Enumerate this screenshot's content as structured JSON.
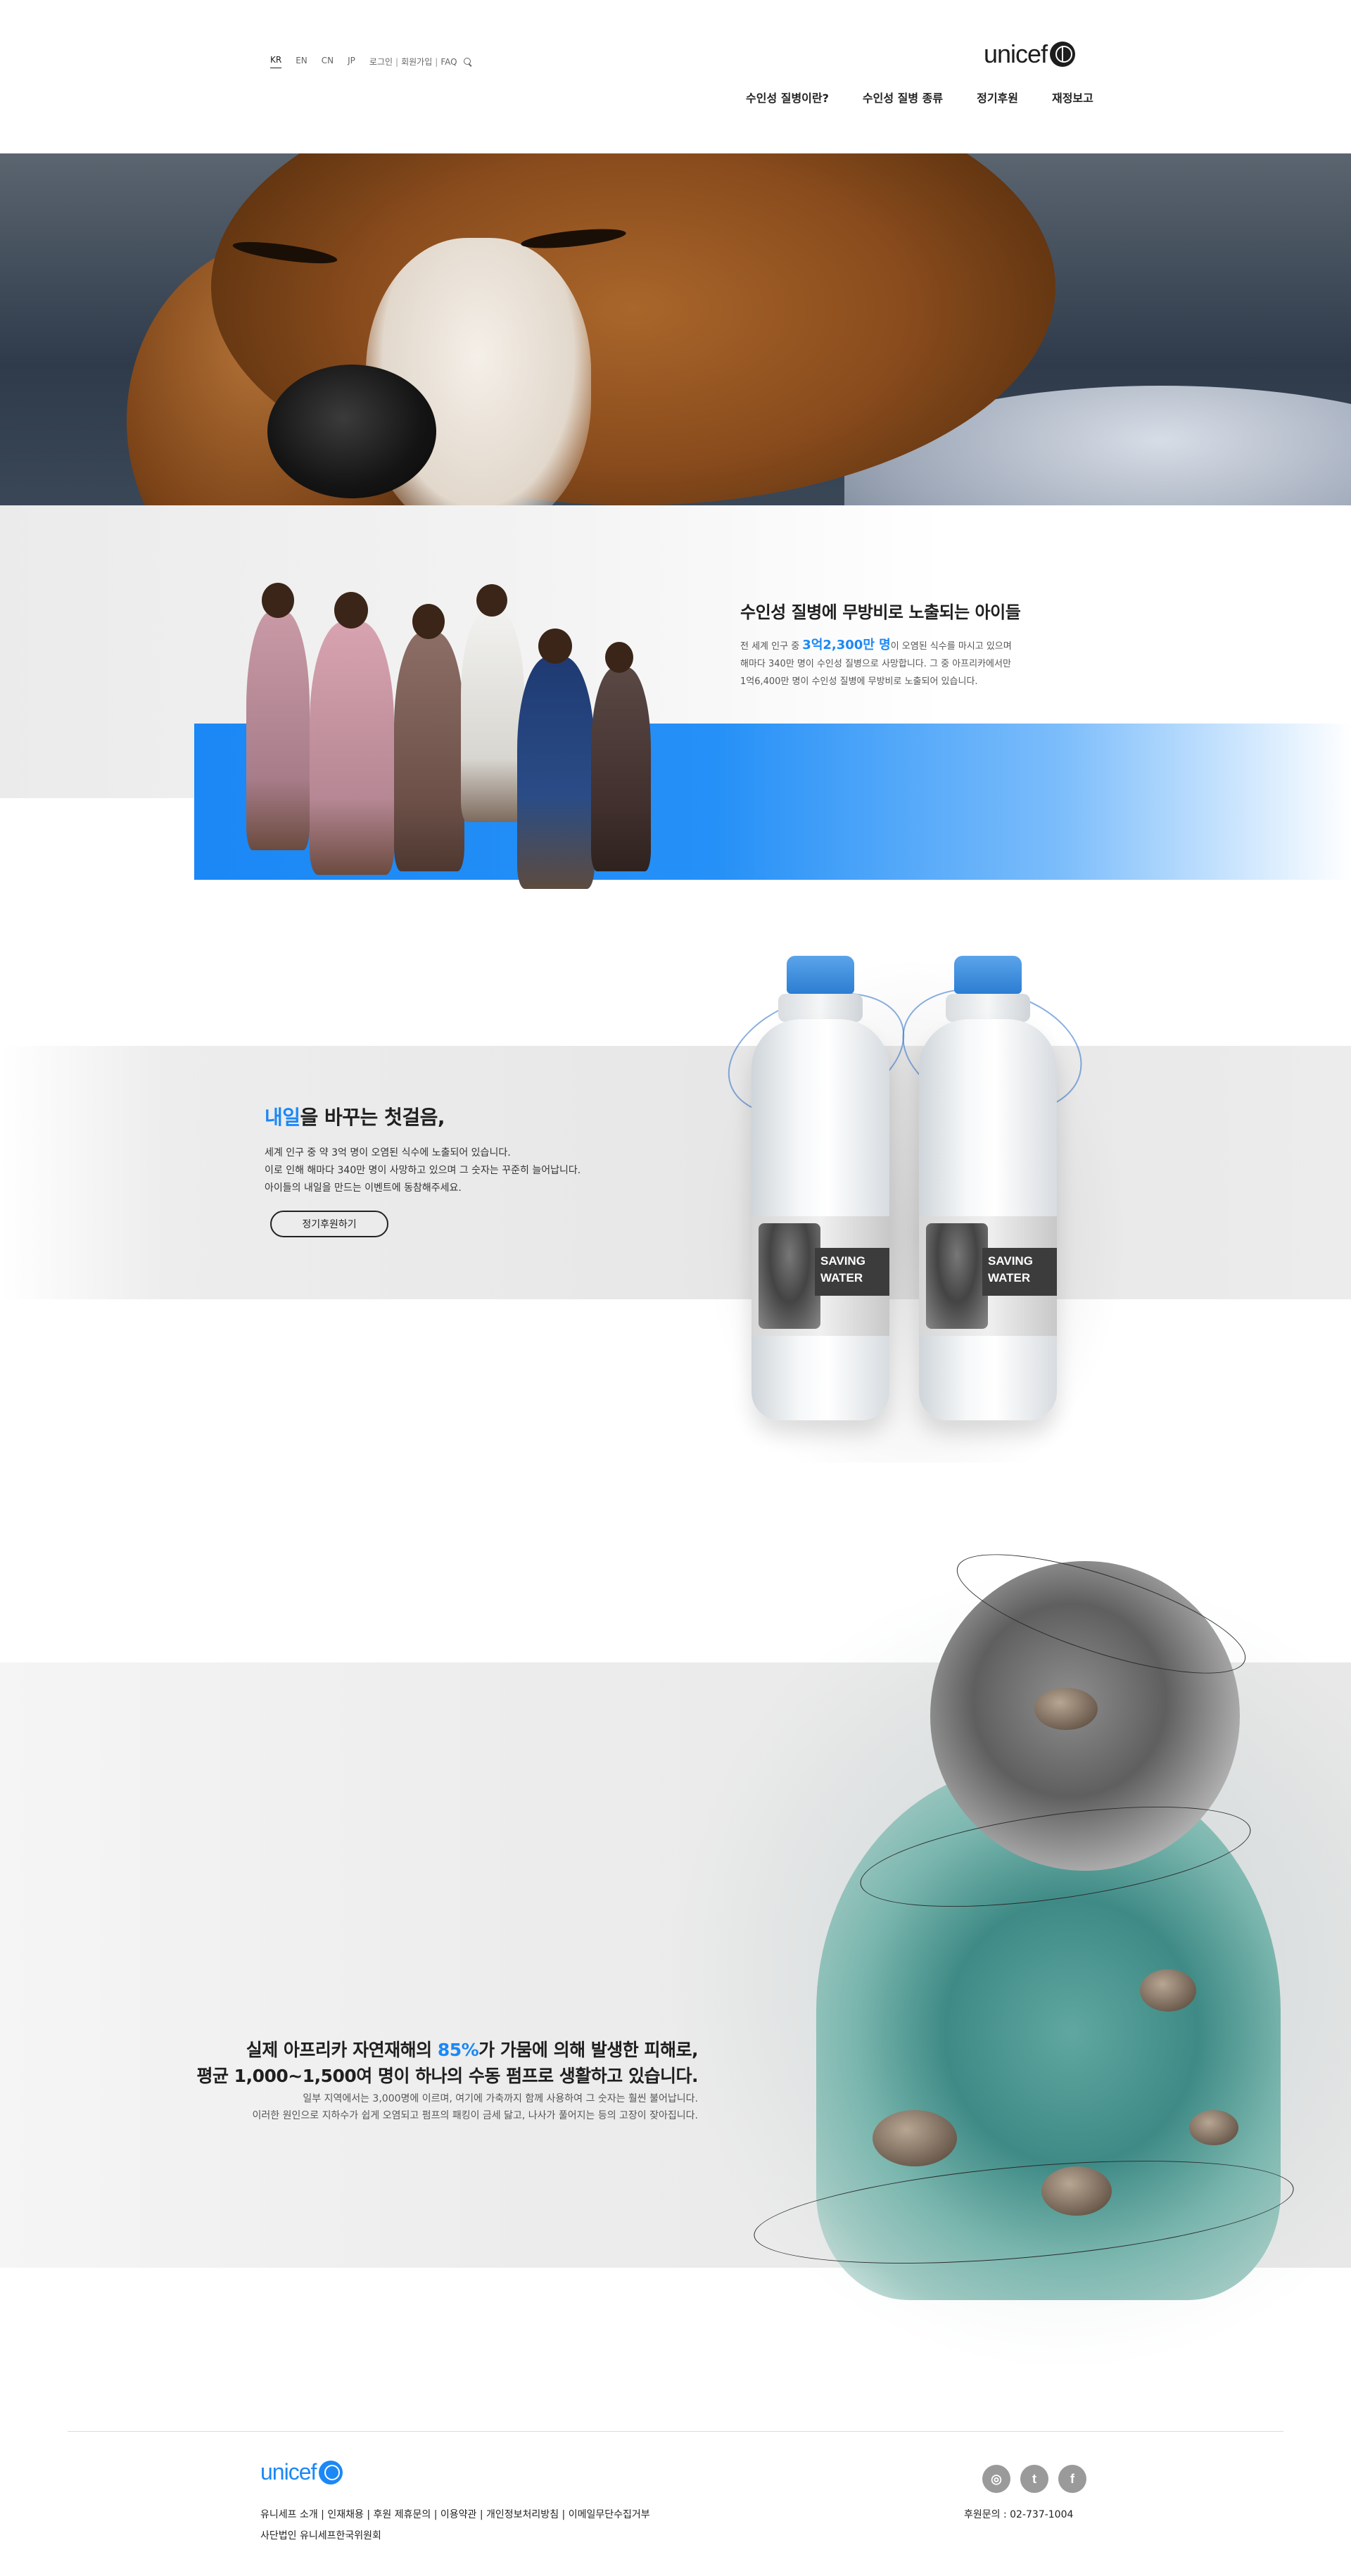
{
  "header": {
    "languages": [
      "KR",
      "EN",
      "CN",
      "JP"
    ],
    "login": "로그인",
    "signup": "회원가입",
    "faq": "FAQ",
    "logo_text": "unicef",
    "nav": [
      "수인성 질병이란?",
      "수인성 질병 종류",
      "정기후원",
      "재정보고"
    ]
  },
  "section_children": {
    "title": "수인성 질병에 무방비로 노출되는 아이들",
    "desc_line1_pre": "전 세계 인구 중 ",
    "desc_line1_highlight": "3억2,300만 명",
    "desc_line1_post": "이 오염된 식수를 마시고 있으며",
    "desc_line2": "해마다 340만 명이 수인성 질병으로 사망합니다. 그 중 아프리카에서만",
    "desc_line3": "1억6,400만 명이 수인성 질병에 무방비로 노출되어 있습니다."
  },
  "section_bottle": {
    "title_highlight": "내일",
    "title_rest": "을 바꾸는 첫걸음,",
    "desc_line1": "세계 인구 중 약 3억 명이 오염된 식수에 노출되어 있습니다.",
    "desc_line2": "이로 인해 해마다 340만 명이 사망하고 있으며 그 숫자는 꾸준히 늘어납니다.",
    "desc_line3": "아이들의 내일을 만드는 이벤트에 동참해주세요.",
    "button_label": "정기후원하기",
    "bottle_label_line1": "SAVING",
    "bottle_label_line2": "WATER"
  },
  "section_africa": {
    "title_line1_pre": "실제 아프리카 자연재해의 ",
    "title_line1_highlight": "85%",
    "title_line1_post": "가 가뭄에 의해 발생한 피해로,",
    "title_line2": "평균 1,000~1,500여 명이 하나의 수동 펌프로 생활하고 있습니다.",
    "desc_line1": "일부 지역에서는 3,000명에 이르며, 여기에 가축까지 함께 사용하여 그 숫자는 훨씬 불어납니다.",
    "desc_line2": "이러한 원인으로 지하수가 쉽게 오염되고 펌프의 패킹이 금세 닳고, 나사가 풀어지는 등의 고장이 잦아집니다."
  },
  "footer": {
    "logo_text": "unicef",
    "links": [
      "유니세프 소개",
      "인재채용",
      "후원 제휴문의",
      "이용약관",
      "개인정보처리방침",
      "이메일무단수집거부"
    ],
    "company": "사단법인 유니세프한국위원회",
    "contact": "후원문의 : 02-737-1004",
    "social_icons": [
      "instagram-icon",
      "twitter-icon",
      "facebook-icon"
    ]
  },
  "colors": {
    "accent": "#1b88f6",
    "dark": "#1f1f1f"
  }
}
